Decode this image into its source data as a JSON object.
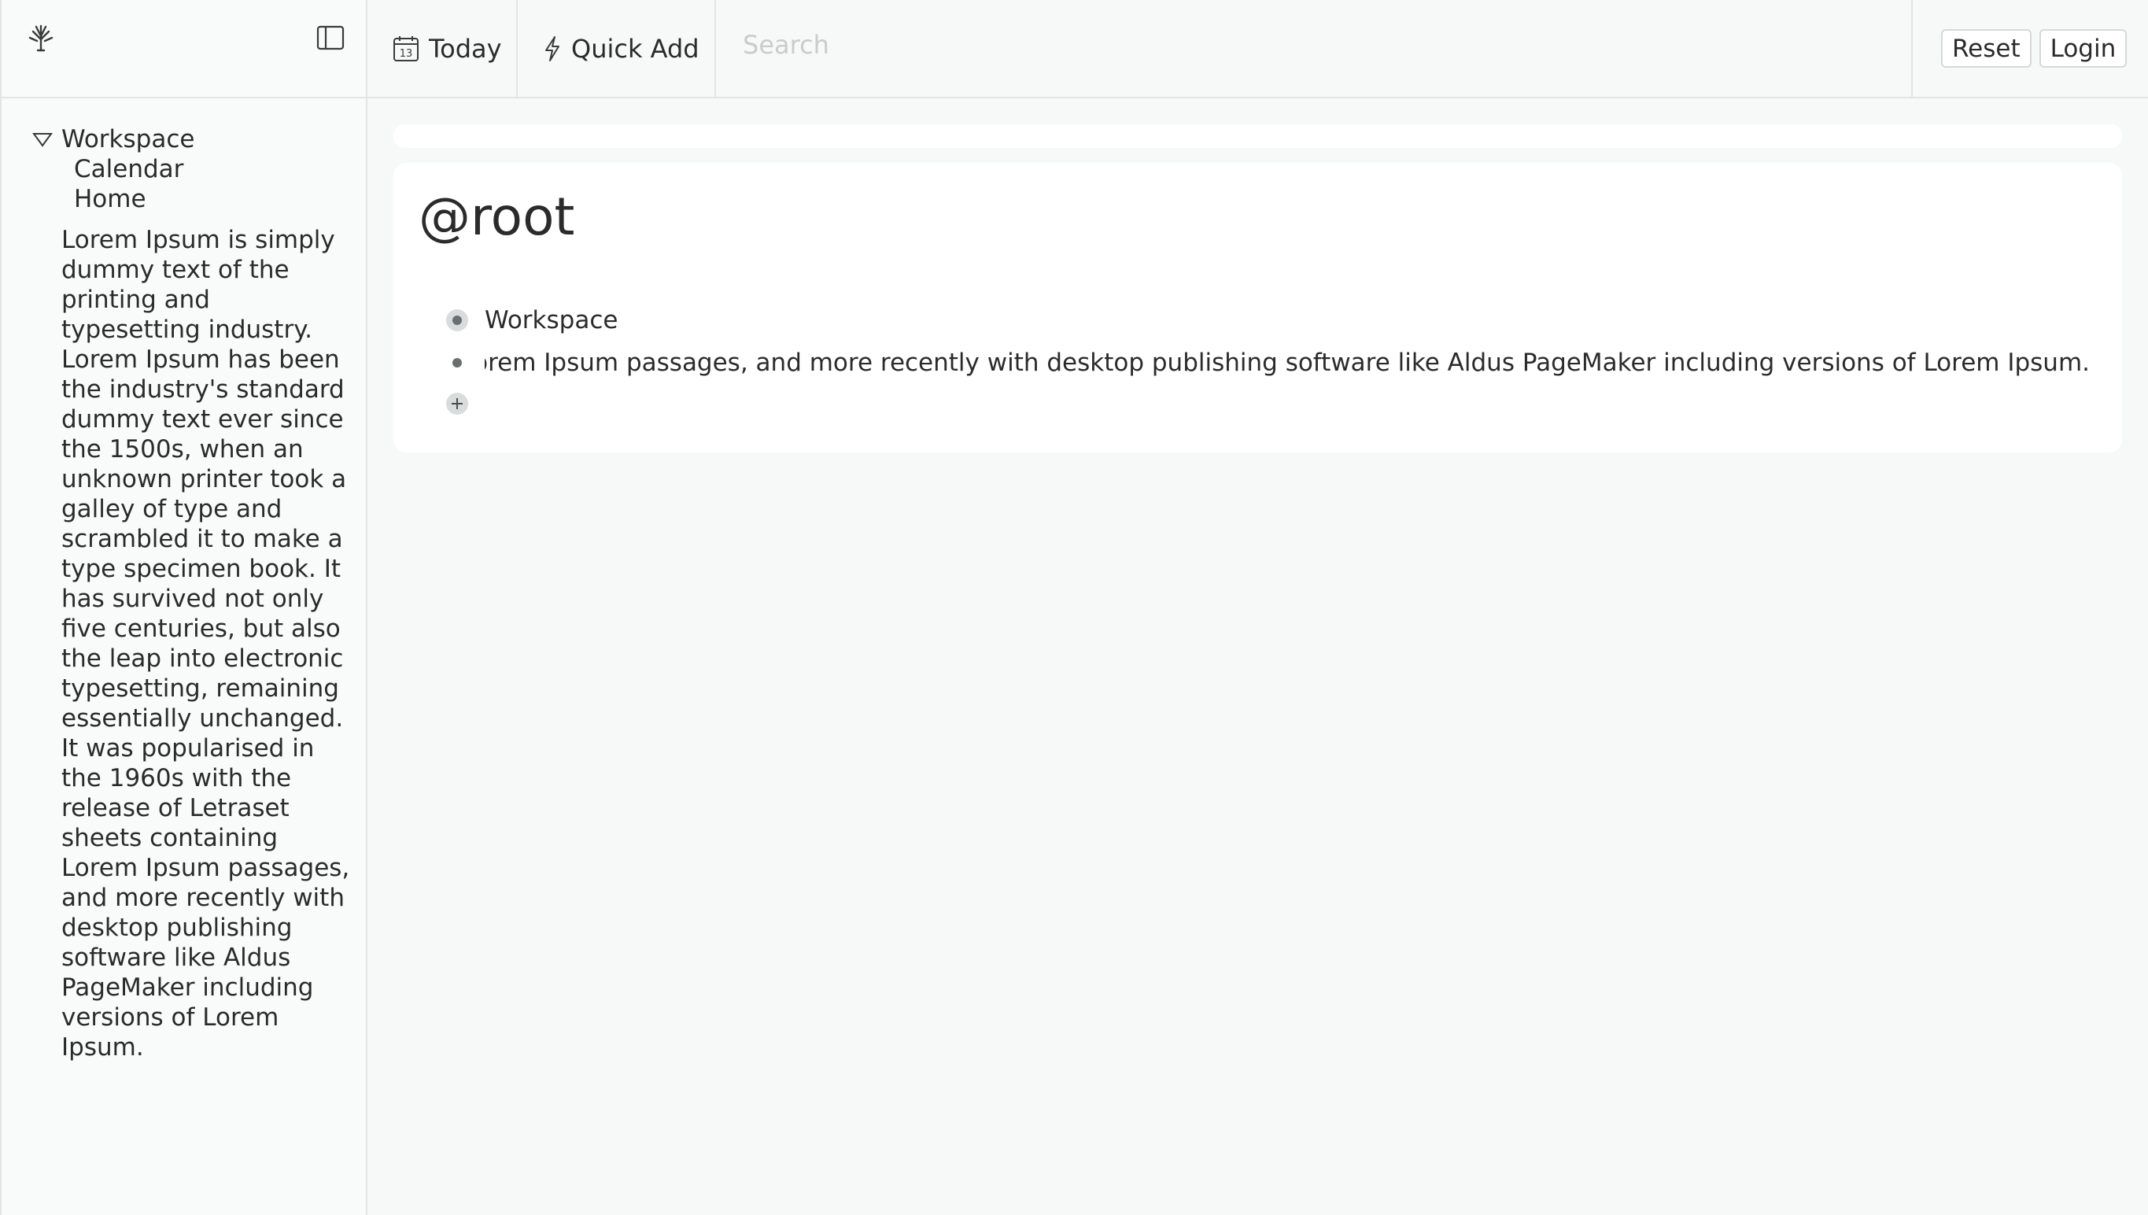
{
  "sidebar": {
    "logo_icon": "tree-logo-icon",
    "toggle_icon": "sidebar-toggle-icon",
    "tree": {
      "root_label": "Workspace",
      "children": [
        "Calendar",
        "Home"
      ]
    },
    "description": "Lorem Ipsum is simply dummy text of the printing and typesetting industry. Lorem Ipsum has been the industry's standard dummy text ever since the 1500s, when an unknown printer took a galley of type and scrambled it to make a type specimen book. It has survived not only five centuries, but also the leap into electronic typesetting, remaining essentially unchanged. It was popularised in the 1960s with the release of Letraset sheets containing Lorem Ipsum passages, and more recently with desktop publishing software like Aldus PageMaker including versions of Lorem Ipsum."
  },
  "topbar": {
    "today_label": "Today",
    "today_icon_number": "13",
    "quick_add_label": "Quick Add",
    "search_placeholder": "Search",
    "reset_label": "Reset",
    "login_label": "Login"
  },
  "main": {
    "title": "@root",
    "items": [
      "Workspace",
      "ntaining Lorem Ipsum passages, and more recently with desktop publishing software like Aldus PageMaker including versions of Lorem Ipsum."
    ]
  },
  "colors": {
    "background": "#f7f8f8",
    "card": "#ffffff",
    "border": "#e3e5e5",
    "text": "#2b2b2b",
    "bullet": "#6b6f70"
  }
}
